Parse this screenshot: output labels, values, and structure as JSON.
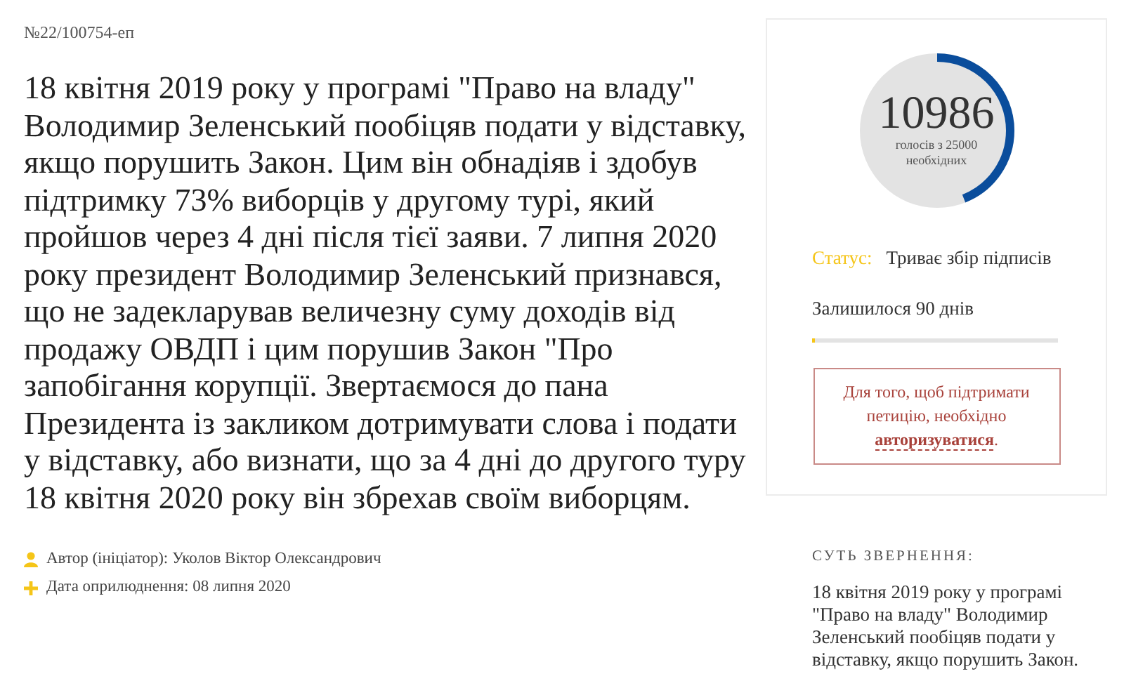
{
  "petition_number": "№22/100754-еп",
  "body": "18 квітня 2019 року у програмі \"Право на владу\" Володимир Зеленський пообіцяв подати у відставку, якщо порушить Закон. Цим він обнадіяв і здобув підтримку 73% виборців у другому турі, який пройшов через 4 дні після тієї заяви. 7 липня 2020 року президент Володимир Зеленський признався, що не задекларував величезну суму доходів від продажу ОВДП і цим порушив Закон \"Про запобігання корупції. Звертаємося до пана Президента із закликом дотримувати слова і подати у відставку, або визнати, що за 4 дні до другого туру 18 квітня 2020 року він збрехав своїм виборцям.",
  "meta": [
    {
      "kind": "author",
      "text": "Автор (ініціатор): Уколов Віктор Олександрович"
    },
    {
      "kind": "date",
      "text": "Дата оприлюднення: 08 липня 2020"
    }
  ],
  "votes": {
    "count": "10986",
    "caption_line_1": "голосів з 25000",
    "caption_line_2": "необхідних",
    "level": 0.44
  },
  "status": {
    "label": "Статус:",
    "value": "Триває збір підписів"
  },
  "remaining": {
    "text": "Залишилося 90 днів",
    "level": 0.01
  },
  "login_notice": {
    "text": "Для того, щоб підтримати петицію, необхідно",
    "link": "авторизуватися",
    "suffix": "."
  },
  "summary": {
    "heading": "СУТЬ ЗВЕРНЕННЯ:",
    "text": "18 квітня 2019 року у програмі \"Право на владу\" Володимир Зеленський пообіцяв подати у відставку, якщо порушить Закон."
  }
}
